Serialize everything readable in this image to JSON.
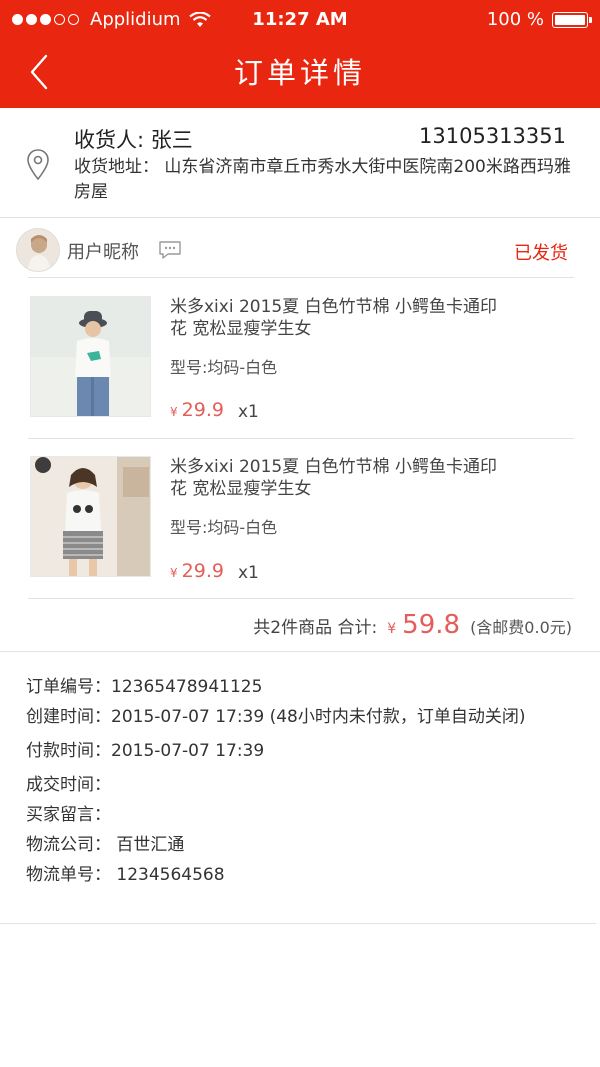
{
  "status_bar": {
    "carrier": "Applidium",
    "time": "11:27 AM",
    "battery": "100 %",
    "battery_level": 1.0,
    "signal_dots_filled": 3,
    "signal_dots_total": 5
  },
  "nav": {
    "title": "订单详情",
    "back_icon": "chevron-left-icon"
  },
  "address": {
    "recipient": "收货人: 张三",
    "phone": "13105313351",
    "address_text": "收货地址： 山东省济南市章丘市秀水大街中医院南200米路西玛雅房屋",
    "icon": "location-pin-icon"
  },
  "shop": {
    "name": "用户昵称",
    "status": "已发货",
    "chat_icon": "chat-bubble-icon"
  },
  "products": [
    {
      "title": "米多xixi 2015夏 白色竹节棉 小鳄鱼卡通印花 宽松显瘦学生女",
      "spec": "型号:均码-白色",
      "currency": "¥",
      "price": "29.9",
      "qty": "x1"
    },
    {
      "title": "米多xixi 2015夏 白色竹节棉 小鳄鱼卡通印花 宽松显瘦学生女",
      "spec": "型号:均码-白色",
      "currency": "¥",
      "price": "29.9",
      "qty": "x1"
    }
  ],
  "summary": {
    "count_label": "共2件商品 合计:",
    "currency": "¥",
    "total": "59.8",
    "shipping": "(含邮费0.0元)"
  },
  "order_info": {
    "order_no": "订单编号：12365478941125",
    "created": "创建时间：2015-07-07 17:39",
    "created_note": "(48小时内未付款，订单自动关闭)",
    "paid": "付款时间：2015-07-07 17:39",
    "deal": "成交时间：",
    "message": "买家留言：",
    "logistics_company": "物流公司：  百世汇通",
    "logistics_no": "物流单号：  1234564568"
  },
  "colors": {
    "brand": "#e9260f",
    "price": "#e45d58",
    "divider": "#e3e3e3"
  }
}
